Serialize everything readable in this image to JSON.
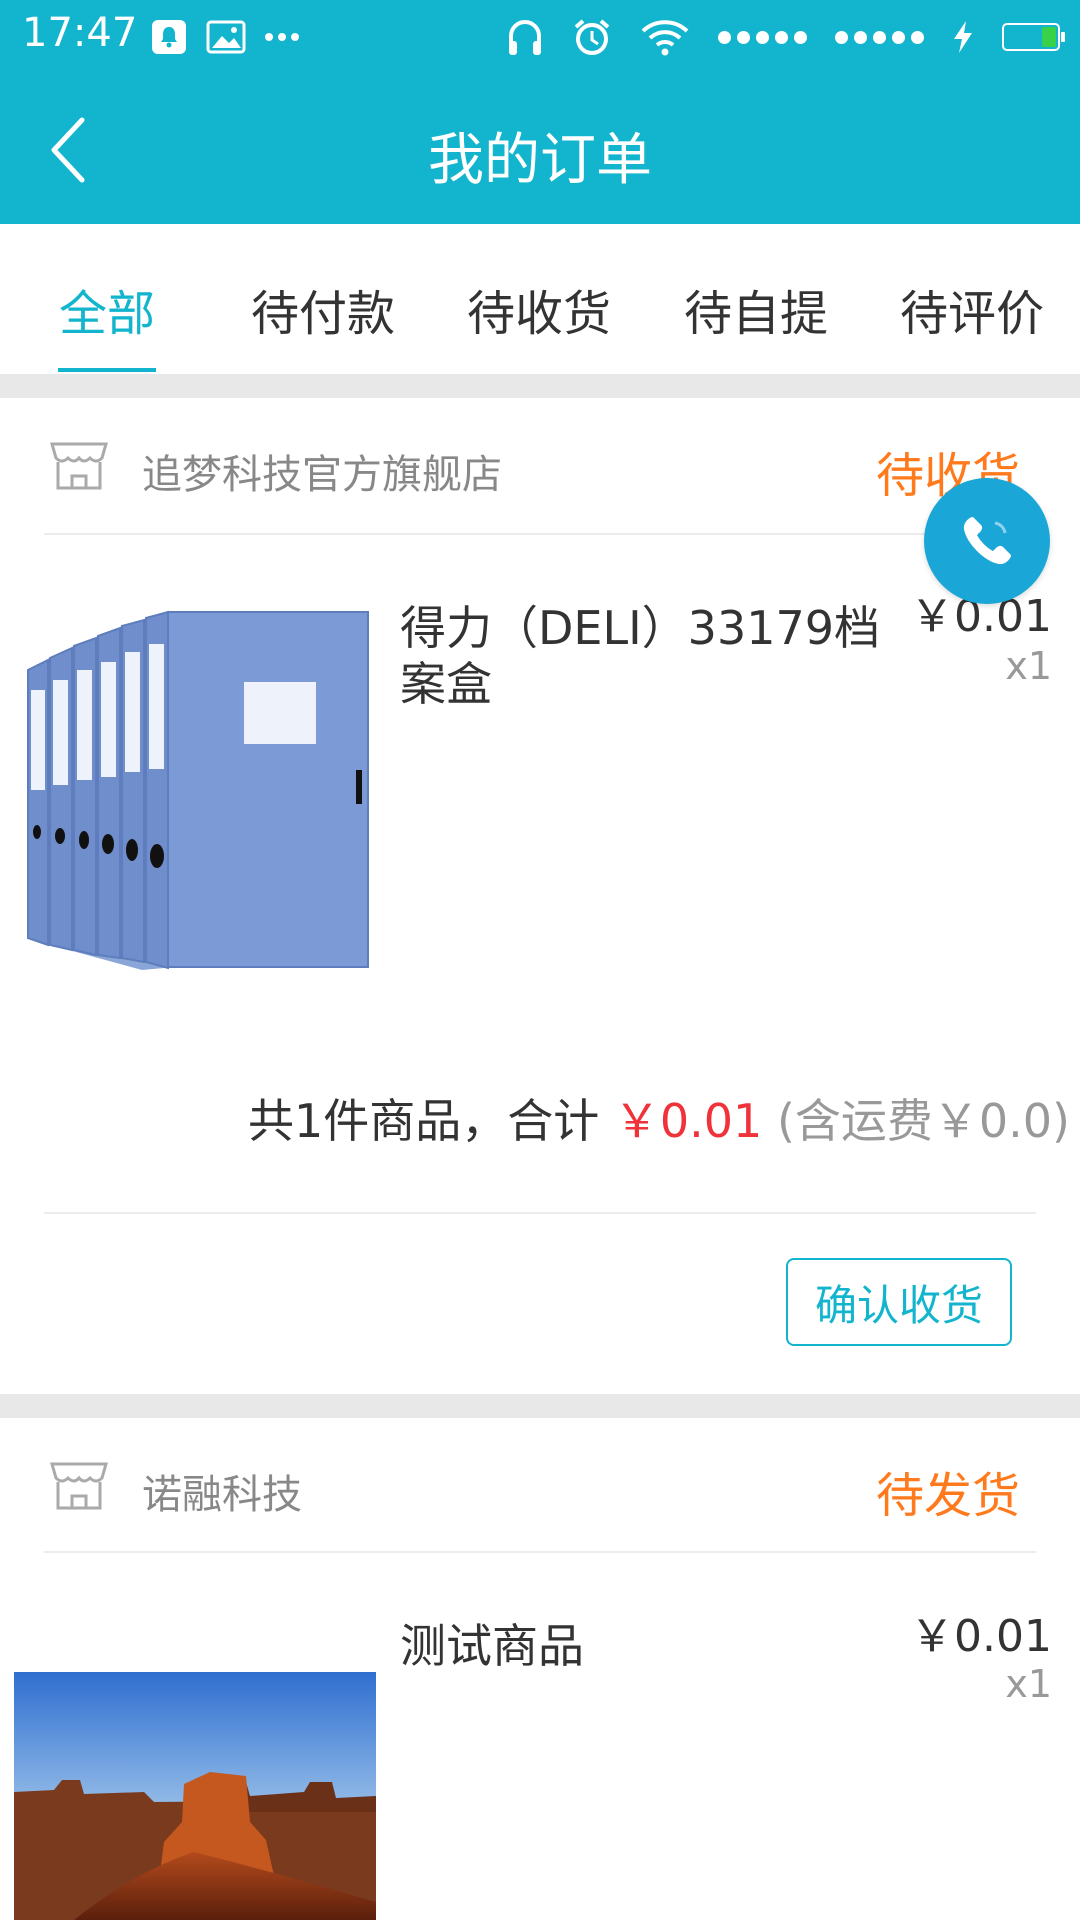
{
  "status_bar": {
    "time": "17:47"
  },
  "nav": {
    "title": "我的订单"
  },
  "tabs": [
    {
      "label": "全部",
      "active": true
    },
    {
      "label": "待付款",
      "active": false
    },
    {
      "label": "待收货",
      "active": false
    },
    {
      "label": "待自提",
      "active": false
    },
    {
      "label": "待评价",
      "active": false
    }
  ],
  "orders": [
    {
      "store": "追梦科技官方旗舰店",
      "status": "待收货",
      "product": {
        "name": "得力（DELI）33179档案盒",
        "price": "￥0.01",
        "qty": "x1",
        "image": "blue-file-boxes"
      },
      "summary": {
        "prefix": "共1件商品，合计",
        "total": "￥0.01",
        "shipping": "(含运费￥0.0)"
      },
      "action_label": "确认收货"
    },
    {
      "store": "诺融科技",
      "status": "待发货",
      "product": {
        "name": "测试商品",
        "price": "￥0.01",
        "qty": "x1",
        "image": "desert-mesa-photo"
      }
    }
  ],
  "colors": {
    "accent": "#12b5cd",
    "status_orange": "#ff7a1c",
    "price_red": "#f0323a"
  }
}
